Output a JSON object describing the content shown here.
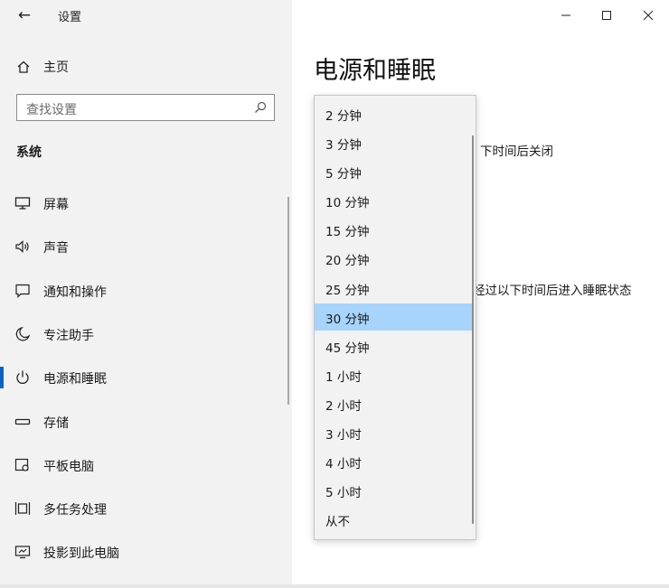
{
  "window": {
    "title": "设置",
    "back_glyph": "←",
    "minimize_glyph": "—",
    "maximize_glyph": "☐",
    "close_glyph": "✕"
  },
  "sidebar": {
    "home_label": "主页",
    "search_placeholder": "查找设置",
    "section_title": "系统",
    "items": [
      {
        "label": "屏幕",
        "icon": "monitor-icon",
        "active": false
      },
      {
        "label": "声音",
        "icon": "speaker-icon",
        "active": false
      },
      {
        "label": "通知和操作",
        "icon": "notification-icon",
        "active": false
      },
      {
        "label": "专注助手",
        "icon": "moon-icon",
        "active": false
      },
      {
        "label": "电源和睡眠",
        "icon": "power-icon",
        "active": true
      },
      {
        "label": "存储",
        "icon": "storage-icon",
        "active": false
      },
      {
        "label": "平板电脑",
        "icon": "tablet-icon",
        "active": false
      },
      {
        "label": "多任务处理",
        "icon": "multitask-icon",
        "active": false
      },
      {
        "label": "投影到此电脑",
        "icon": "projector-icon",
        "active": false
      }
    ]
  },
  "main": {
    "page_title": "电源和睡眠",
    "screen_off_text": "下时间后关闭",
    "sleep_text": "经过以下时间后进入睡眠状态"
  },
  "dropdown": {
    "selected": "30 分钟",
    "options": [
      "2 分钟",
      "3 分钟",
      "5 分钟",
      "10 分钟",
      "15 分钟",
      "20 分钟",
      "25 分钟",
      "30 分钟",
      "45 分钟",
      "1 小时",
      "2 小时",
      "3 小时",
      "4 小时",
      "5 小时",
      "从不"
    ]
  },
  "colors": {
    "accent": "#0a64c8",
    "selection": "#a7d4fb",
    "sidebar_bg": "#f2f2f2"
  }
}
